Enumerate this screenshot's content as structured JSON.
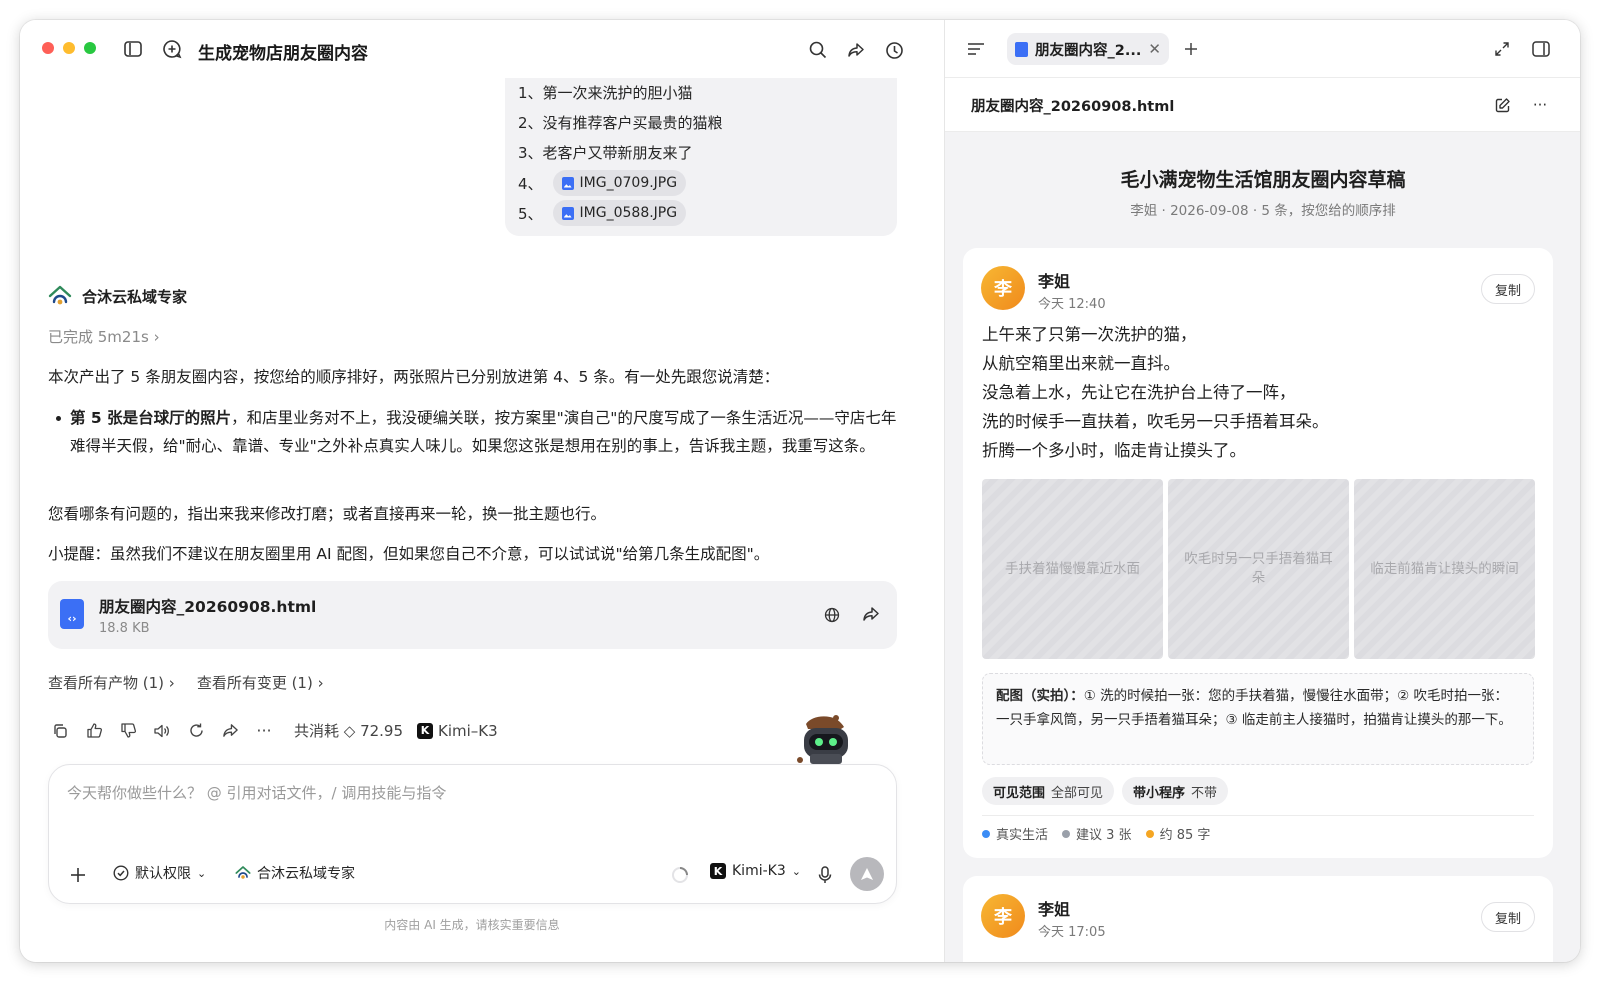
{
  "window": {
    "title": "生成宠物店朋友圈内容"
  },
  "colors": {
    "close": "#fe5f57",
    "minimize": "#febc2e",
    "zoom": "#28c840",
    "accent": "#3b6ff5",
    "avatar": "#f5a623"
  },
  "user_message": {
    "lines": [
      {
        "num": "1、",
        "text": "第一次来洗护的胆小猫"
      },
      {
        "num": "2、",
        "text": "没有推荐客户买最贵的猫粮"
      },
      {
        "num": "3、",
        "text": "老客户又带新朋友来了"
      },
      {
        "num": "4、",
        "file": "IMG_0709.JPG"
      },
      {
        "num": "5、",
        "file": "IMG_0588.JPG"
      }
    ]
  },
  "assistant": {
    "name": "合沐云私域专家",
    "status": "已完成 5m21s",
    "intro": "本次产出了 5 条朋友圈内容，按您给的顺序排好，两张照片已分别放进第 4、5 条。有一处先跟您说清楚：",
    "bullet_bold": "第 5 张是台球厅的照片",
    "bullet_rest": "，和店里业务对不上，我没硬编关联，按方案里\"演自己\"的尺度写成了一条生活近况——守店七年难得半天假，给\"耐心、靠谱、专业\"之外补点真实人味儿。如果您这张是想用在别的事上，告诉我主题，我重写这条。",
    "para2": "您看哪条有问题的，指出来我来修改打磨；或者直接再来一轮，换一批主题也行。",
    "para3": "小提醒：虽然我们不建议在朋友圈里用 AI 配图，但如果您自己不介意，可以试试说\"给第几条生成配图\"。",
    "file": {
      "name": "朋友圈内容_20260908.html",
      "size": "18.8 KB"
    },
    "link_products": "查看所有产物 (1)",
    "link_changes": "查看所有变更 (1)",
    "cost": "共消耗 ◇ 72.95",
    "model": "Kimi–K3"
  },
  "composer": {
    "placeholder": "今天帮你做些什么？ @ 引用对话文件，/ 调用技能与指令",
    "permission": "默认权限",
    "agent": "合沐云私域专家",
    "model": "Kimi-K3",
    "footer": "内容由 AI 生成，请核实重要信息"
  },
  "preview": {
    "tab_label": "朋友圈内容_2...",
    "file_name": "朋友圈内容_20260908.html",
    "doc_title": "毛小满宠物生活馆朋友圈内容草稿",
    "doc_subtitle": "李姐 · 2026-09-08 · 5 条，按您给的顺序排",
    "copy_label": "复制",
    "posts": [
      {
        "avatar": "李",
        "author": "李姐",
        "time": "今天 12:40",
        "lines": [
          "上午来了只第一次洗护的猫，",
          "从航空箱里出来就一直抖。",
          "没急着上水，先让它在洗护台上待了一阵，",
          "洗的时候手一直扶着，吹毛另一只手捂着耳朵。",
          "折腾一个多小时，临走肯让摸头了。"
        ],
        "photos": [
          "手扶着猫慢慢靠近水面",
          "吹毛时另一只手捂着猫耳朵",
          "临走前猫肯让摸头的瞬间"
        ],
        "caption_label": "配图（实拍）：",
        "caption_text": "① 洗的时候拍一张：您的手扶着猫，慢慢往水面带；② 吹毛时拍一张：一只手拿风筒，另一只手捂着猫耳朵；③ 临走前主人接猫时，拍猫肯让摸头的那一下。",
        "visibility_label": "可见范围",
        "visibility_value": "全部可见",
        "miniprogram_label": "带小程序",
        "miniprogram_value": "不带",
        "meta": [
          {
            "text": "真实生活",
            "color": "#3b8cf5"
          },
          {
            "text": "建议 3 张",
            "color": "#9aa0aa"
          },
          {
            "text": "约 85 字",
            "color": "#f5a623"
          }
        ]
      },
      {
        "avatar": "李",
        "author": "李姐",
        "time": "今天 17:05"
      }
    ]
  }
}
